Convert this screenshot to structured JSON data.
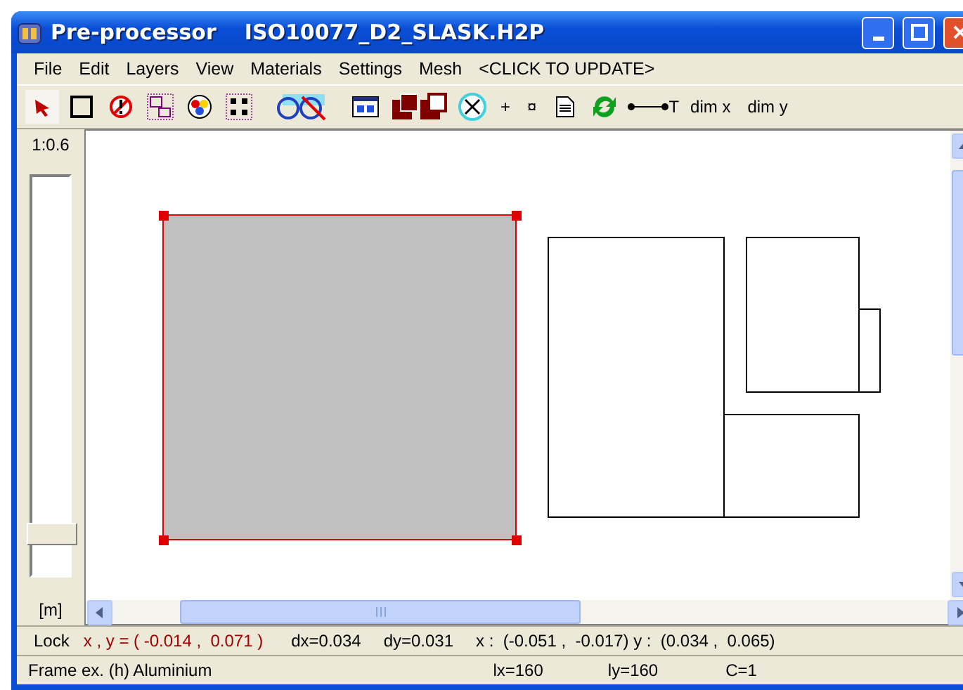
{
  "window": {
    "title": "Pre-processor",
    "file": "ISO10077_D2_SLASK.H2P"
  },
  "menu": [
    {
      "label": "File"
    },
    {
      "label": "Edit"
    },
    {
      "label": "Layers"
    },
    {
      "label": "View"
    },
    {
      "label": "Materials"
    },
    {
      "label": "Settings"
    },
    {
      "label": "Mesh"
    },
    {
      "label": "<CLICK TO UPDATE>"
    }
  ],
  "toolbar": [
    {
      "kind": "pointer",
      "selected": true
    },
    {
      "kind": "square",
      "selected": false
    },
    {
      "kind": "forbidden",
      "selected": false
    },
    {
      "kind": "frames",
      "selected": false
    },
    {
      "kind": "palette",
      "selected": false
    },
    {
      "kind": "dots",
      "selected": false
    },
    {
      "kind": "gap"
    },
    {
      "kind": "circles",
      "selected": false
    },
    {
      "kind": "gap"
    },
    {
      "kind": "panel",
      "selected": false
    },
    {
      "kind": "layers",
      "selected": false
    },
    {
      "kind": "cross",
      "selected": false
    },
    {
      "kind": "text",
      "label": "+"
    },
    {
      "kind": "text",
      "label": "¤"
    },
    {
      "kind": "document",
      "selected": false
    },
    {
      "kind": "refresh",
      "selected": false
    },
    {
      "kind": "measure",
      "label": "T"
    },
    {
      "kind": "text",
      "label": "dim x"
    },
    {
      "kind": "text",
      "label": "dim y"
    }
  ],
  "zoom_panel": {
    "scale": "1:0.6",
    "level": 0.1,
    "unit": "[m]"
  },
  "status_bar": {
    "lock": "Lock",
    "cursor": "x , y = ( -0.014 ,  0.071 )",
    "dx": "dx=0.034",
    "dy": "dy=0.031",
    "extent": "x :  (-0.051 ,  -0.017) y :  (0.034 ,  0.065)"
  },
  "info_bar": {
    "selection": "Frame ex. (h) Aluminium",
    "lx": "lx=160",
    "ly": "ly=160",
    "c": "C=1"
  }
}
